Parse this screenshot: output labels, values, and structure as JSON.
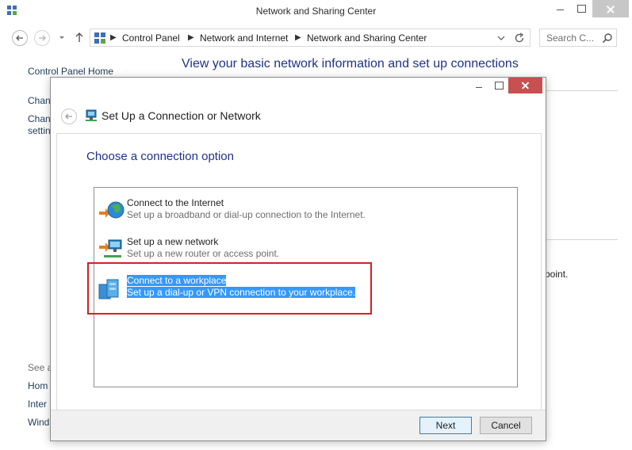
{
  "window": {
    "title": "Network and Sharing Center"
  },
  "navigation": {
    "breadcrumbs": [
      "Control Panel",
      "Network and Internet",
      "Network and Sharing Center"
    ],
    "search_placeholder": "Search C..."
  },
  "background": {
    "control_panel_home": "Control Panel Home",
    "sidebar_links": [
      "Chan",
      "Chan",
      "settin"
    ],
    "see_also": "See a",
    "see_also_links": [
      "Hom",
      "Inter",
      "Wind"
    ],
    "main_heading": "View your basic network information and set up connections",
    "right_fragment": "point."
  },
  "dialog": {
    "title": "Set Up a Connection or Network",
    "heading": "Choose a connection option",
    "options": [
      {
        "title": "Connect to the Internet",
        "description": "Set up a broadband or dial-up connection to the Internet.",
        "icon": "internet-globe-icon",
        "selected": false
      },
      {
        "title": "Set up a new network",
        "description": "Set up a new router or access point.",
        "icon": "new-network-icon",
        "selected": false
      },
      {
        "title": "Connect to a workplace",
        "description": "Set up a dial-up or VPN connection to your workplace.",
        "icon": "workplace-icon",
        "selected": true
      }
    ],
    "next_label": "Next",
    "cancel_label": "Cancel"
  },
  "colors": {
    "selection": "#3399ff",
    "highlight_border": "#d61f26",
    "heading_blue": "#1e3287"
  }
}
